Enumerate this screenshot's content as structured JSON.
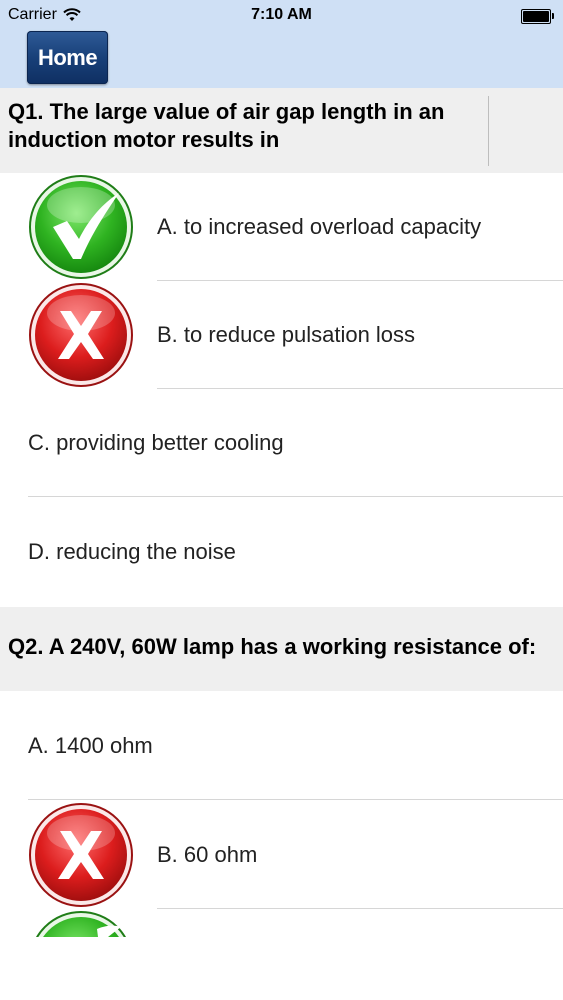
{
  "status_bar": {
    "carrier": "Carrier",
    "time": "7:10 AM"
  },
  "nav": {
    "home_label": "Home"
  },
  "colors": {
    "header_bg": "#cfe0f5",
    "question_bg": "#efefef",
    "correct": "#3fbf2f",
    "wrong": "#d81e1e"
  },
  "questions": [
    {
      "text": "Q1. The large value of air gap length in an induction motor results in",
      "options": [
        {
          "label": "A. to increased overload capacity",
          "mark": "check-icon"
        },
        {
          "label": "B.  to reduce pulsation loss",
          "mark": "cross-icon"
        },
        {
          "label": "C. providing better cooling",
          "mark": ""
        },
        {
          "label": "D. reducing the noise",
          "mark": ""
        }
      ]
    },
    {
      "text": "Q2. A 240V, 60W lamp has a working resistance of:",
      "options": [
        {
          "label": "A. 1400 ohm",
          "mark": ""
        },
        {
          "label": "B. 60 ohm",
          "mark": "cross-icon"
        }
      ]
    }
  ]
}
